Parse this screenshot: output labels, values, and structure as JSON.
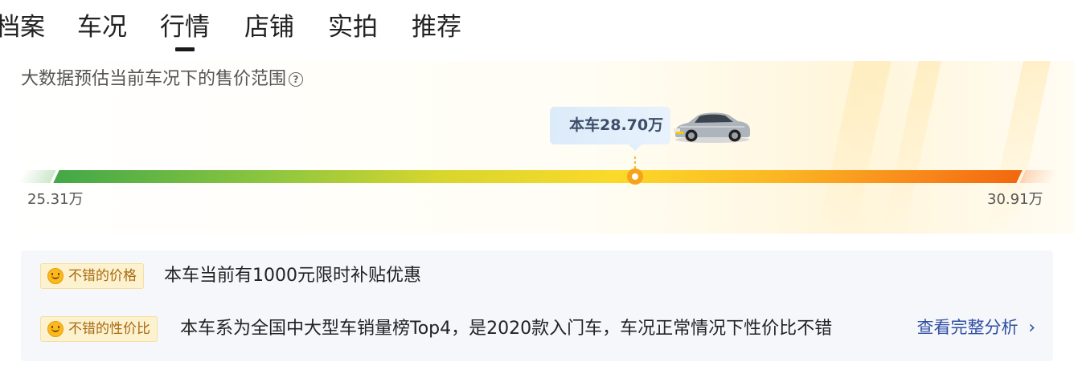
{
  "tabs": [
    {
      "label": "档案",
      "active": false
    },
    {
      "label": "车况",
      "active": false
    },
    {
      "label": "行情",
      "active": true
    },
    {
      "label": "店铺",
      "active": false
    },
    {
      "label": "实拍",
      "active": false
    },
    {
      "label": "推荐",
      "active": false
    }
  ],
  "price_range": {
    "subtitle": "大数据预估当前车况下的售价范围",
    "current_label": "本车28.70万",
    "min_label": "25.31万",
    "max_label": "30.91万",
    "min_value_wan": 25.31,
    "max_value_wan": 30.91,
    "current_value_wan": 28.7,
    "help_icon": "question-circle-icon"
  },
  "analysis": {
    "items": [
      {
        "badge": "不错的价格",
        "text": "本车当前有1000元限时补贴优惠"
      },
      {
        "badge": "不错的性价比",
        "text": "本车系为全国中大型车销量榜Top4，是2020款入门车，车况正常情况下性价比不错"
      }
    ],
    "link_label": "查看完整分析",
    "link_icon": "chevron-right-icon"
  },
  "colors": {
    "bar_start": "#43a847",
    "bar_mid": "#fbd92a",
    "bar_end": "#f2680e",
    "link": "#2f4fa3",
    "badge_bg": "#fdf2cf"
  }
}
